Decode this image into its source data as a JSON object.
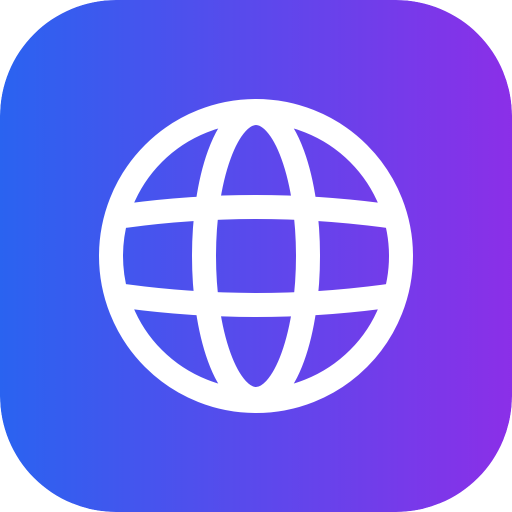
{
  "icon": {
    "name": "globe-icon",
    "gradient_start_color": "#2A63F0",
    "gradient_end_color": "#8B2FE8",
    "glyph_color": "#FFFFFF"
  }
}
